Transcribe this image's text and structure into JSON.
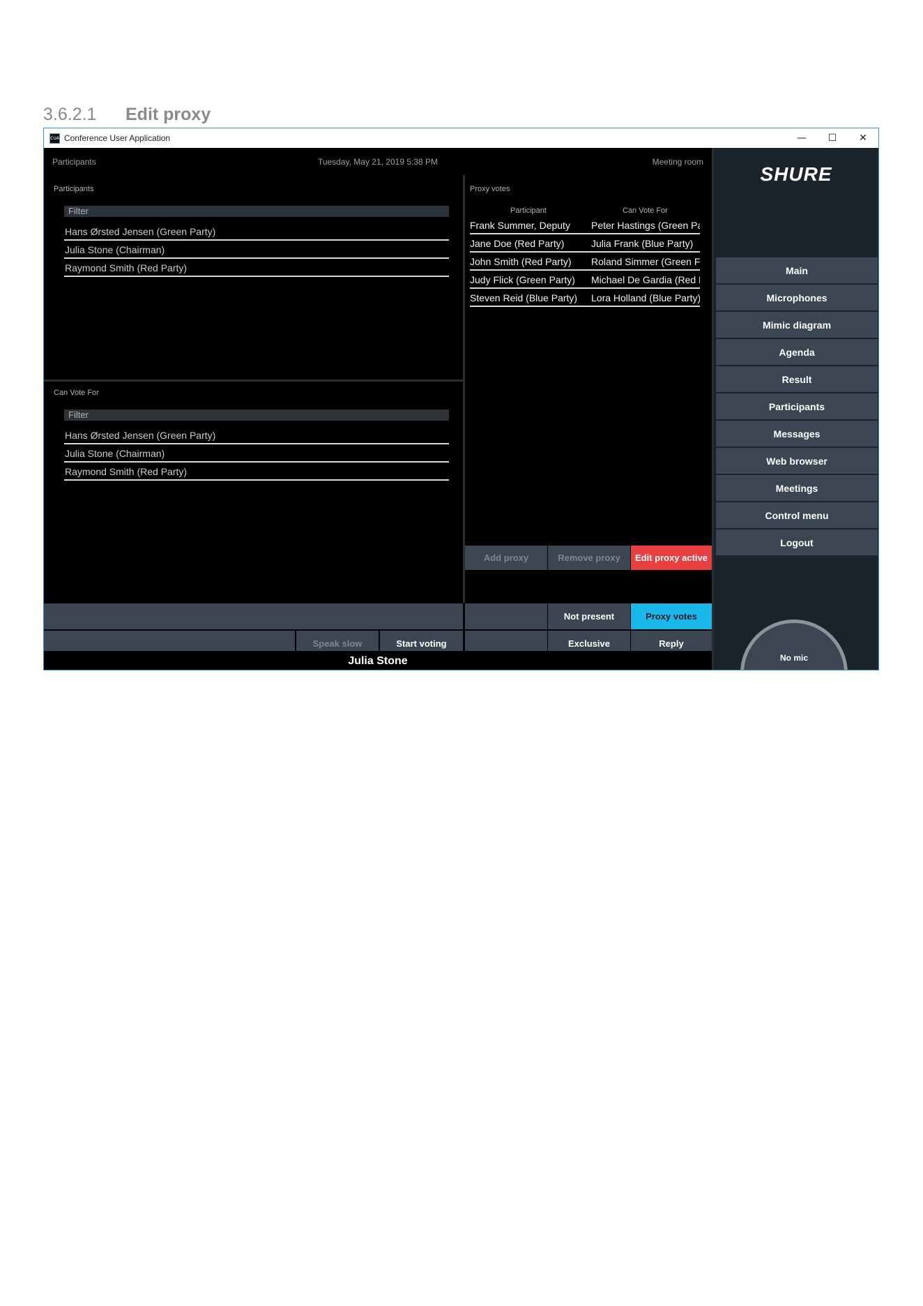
{
  "doc": {
    "section_number": "3.6.2.1",
    "section_title": "Edit proxy"
  },
  "window": {
    "title": "Conference User Application",
    "icon_text": "CUA",
    "controls": {
      "minimize": "—",
      "maximize": "☐",
      "close": "✕"
    }
  },
  "topbar": {
    "left": "Participants",
    "center": "Tuesday, May 21, 2019 5:38 PM",
    "right": "Meeting room"
  },
  "participants_panel": {
    "caption": "Participants",
    "filter": "Filter",
    "items": [
      "Hans Ørsted Jensen  (Green Party)",
      "Julia Stone (Chairman)",
      "Raymond Smith (Red Party)"
    ]
  },
  "can_vote_panel": {
    "caption": "Can Vote For",
    "filter": "Filter",
    "items": [
      "Hans Ørsted Jensen  (Green Party)",
      "Julia Stone (Chairman)",
      "Raymond Smith (Red Party)"
    ]
  },
  "proxy_votes": {
    "caption": "Proxy votes",
    "headers": {
      "participant": "Participant",
      "can_vote_for": "Can Vote For"
    },
    "rows": [
      {
        "participant": "Frank Summer,  Deputy",
        "can_vote_for": "Peter Hastings (Green Pa"
      },
      {
        "participant": "Jane Doe  (Red Party)",
        "can_vote_for": "Julia Frank (Blue Party)"
      },
      {
        "participant": "John Smith (Red Party)",
        "can_vote_for": "Roland  Simmer (Green F"
      },
      {
        "participant": "Judy Flick (Green Party)",
        "can_vote_for": "Michael De Gardia (Red F"
      },
      {
        "participant": "Steven Reid (Blue Party)",
        "can_vote_for": "Lora Holland (Blue Party)"
      }
    ],
    "buttons": {
      "add": "Add proxy",
      "remove": "Remove proxy",
      "edit": "Edit proxy active"
    }
  },
  "bottom_buttons": {
    "not_present": "Not present",
    "proxy_votes": "Proxy votes",
    "speak_slow": "Speak slow",
    "start_voting": "Start voting",
    "exclusive": "Exclusive",
    "reply": "Reply"
  },
  "footer": {
    "name": "Julia Stone"
  },
  "sidebar": {
    "logo": "SHURE",
    "nav": [
      {
        "label": "Main"
      },
      {
        "label": "Microphones"
      },
      {
        "label": "Mimic diagram"
      },
      {
        "label": "Agenda"
      },
      {
        "label": "Result"
      },
      {
        "label": "Participants"
      },
      {
        "label": "Messages"
      },
      {
        "label": "Web browser"
      },
      {
        "label": "Meetings"
      },
      {
        "label": "Control menu"
      },
      {
        "label": "Logout"
      }
    ],
    "active_index": 5,
    "mic": "No mic"
  },
  "colors": {
    "accent": "#1ab7ea",
    "danger": "#e84040",
    "button": "#3b4652",
    "sidebar": "#1c242b"
  }
}
